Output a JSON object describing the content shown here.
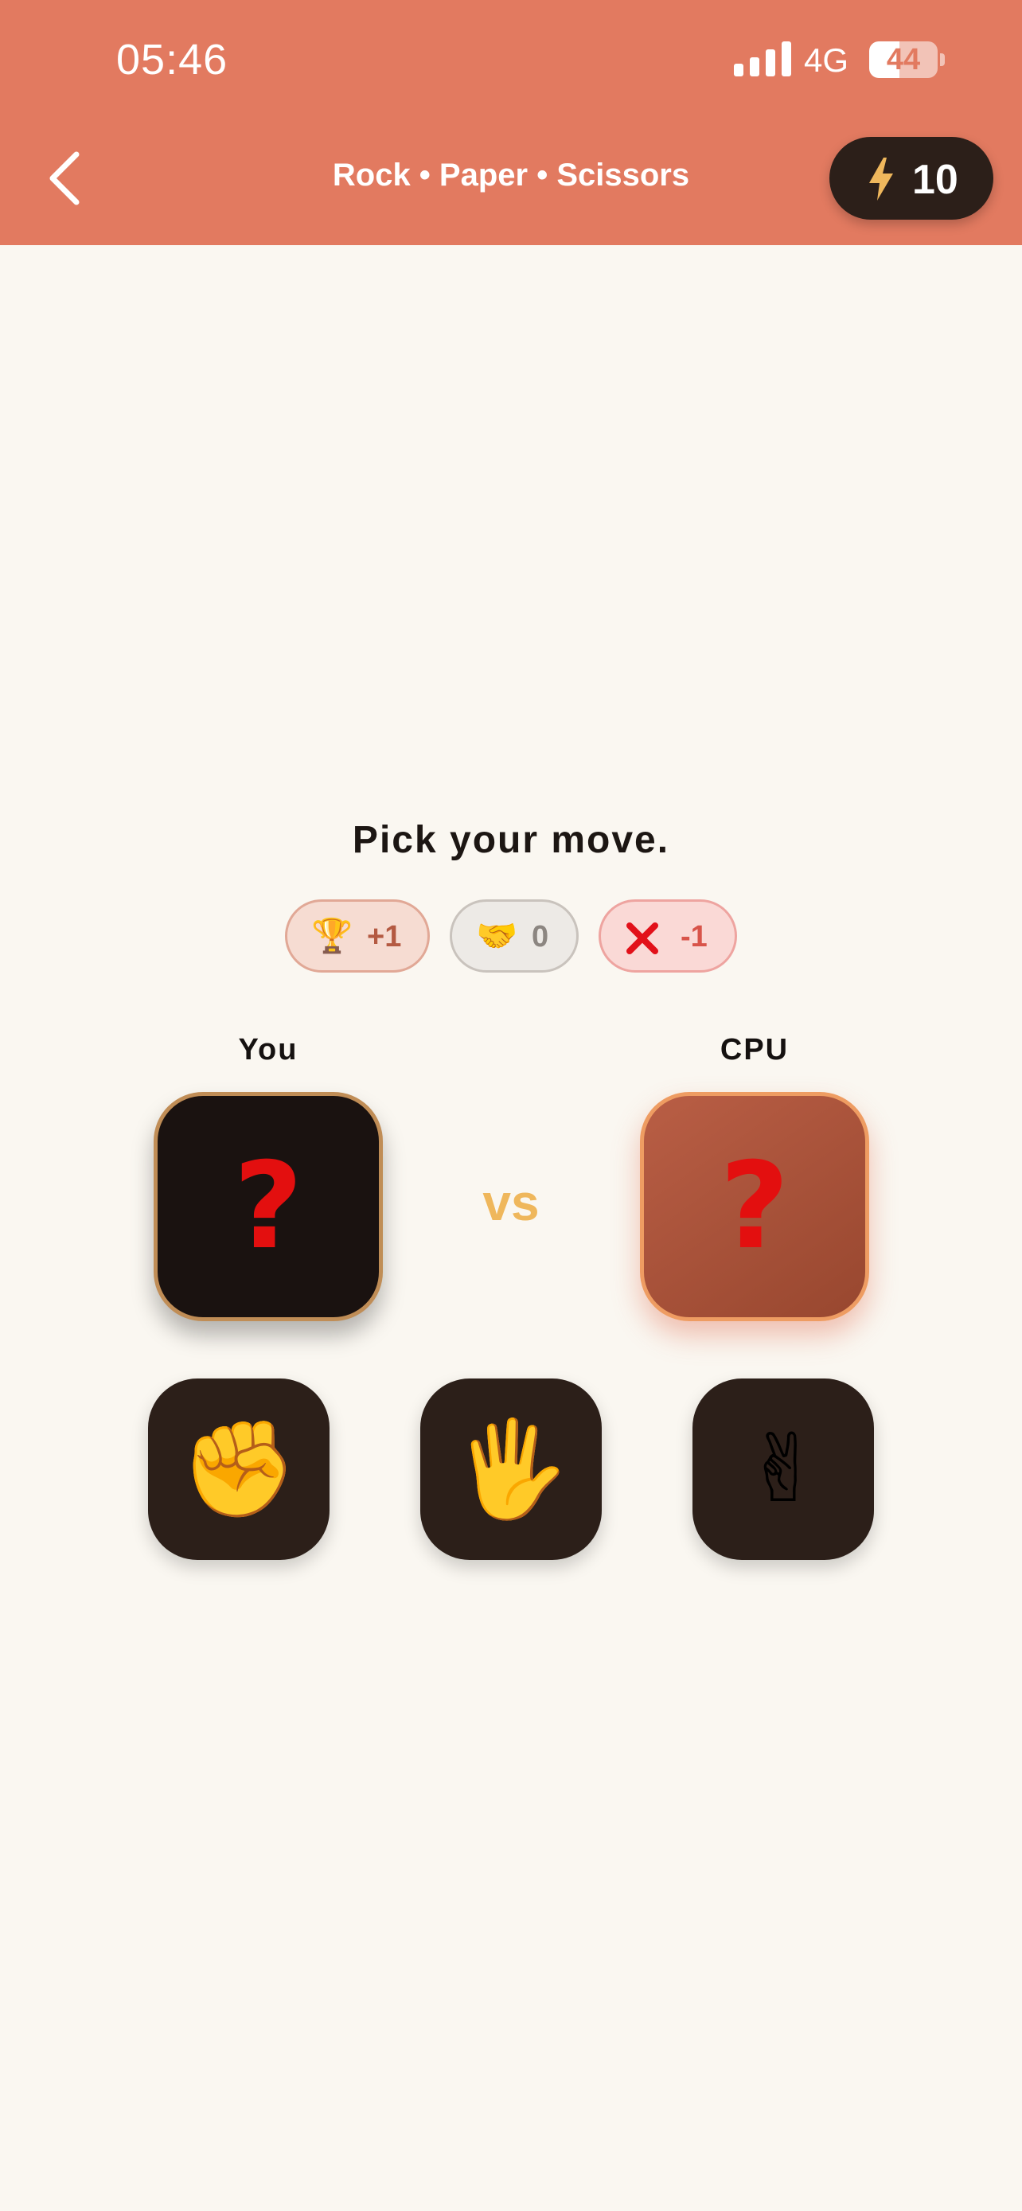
{
  "status_bar": {
    "time": "05:46",
    "network": "4G",
    "battery": "44",
    "battery_level": 0.44,
    "signal_icon": "cellular-signal-icon"
  },
  "nav": {
    "back_icon": "chevron-left-icon",
    "title": "Rock • Paper • Scissors",
    "energy_icon": "lightning-bolt-icon",
    "energy_count": "10"
  },
  "prompt": "Pick your move.",
  "score": {
    "win": {
      "icon": "🏆",
      "icon_name": "trophy-icon",
      "value": "+1"
    },
    "draw": {
      "icon": "🤝",
      "icon_name": "handshake-icon",
      "value": "0"
    },
    "loss": {
      "icon_name": "x-icon",
      "value": "-1"
    }
  },
  "players": {
    "you": {
      "label": "You",
      "choice": "?"
    },
    "cpu": {
      "label": "CPU",
      "choice": "?"
    },
    "versus": "vs"
  },
  "moves": [
    {
      "name": "rock",
      "icon": "✊",
      "icon_name": "raised-fist-icon"
    },
    {
      "name": "paper",
      "icon": "🖐",
      "icon_name": "raised-hand-icon"
    },
    {
      "name": "scissors",
      "icon": "✌",
      "icon_name": "victory-hand-icon"
    }
  ],
  "colors": {
    "header": "#E27A60",
    "background": "#FAF7F1",
    "dark": "#2C1F19",
    "accent_gold": "#EFB75C",
    "question": "#E30F0F"
  }
}
